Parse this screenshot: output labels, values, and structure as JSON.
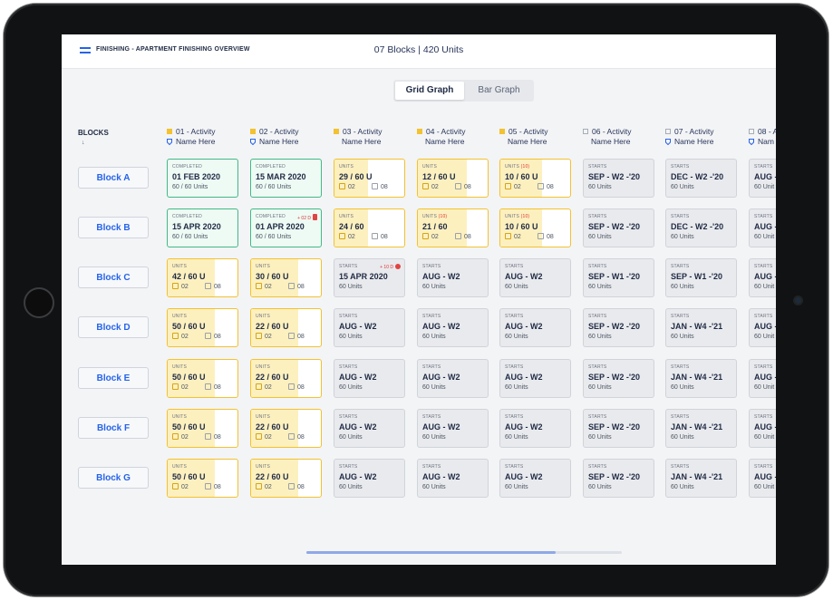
{
  "header": {
    "breadcrumb": "FINISHING - APARTMENT FINISHING OVERVIEW",
    "stats": "07 Blocks | 420 Units"
  },
  "view_toggle": {
    "options": [
      "Grid Graph",
      "Bar Graph"
    ],
    "selected": "Grid Graph"
  },
  "blocks_label": "BLOCKS",
  "sort_icon": "sort-down-arrow-icon",
  "colors": {
    "completed_border": "#43b987",
    "progress_border": "#f2c230",
    "progress_fill": "#fdf0bf",
    "activity_started": "#f2c230",
    "accent_blue": "#2563eb",
    "delay_red": "#e04444"
  },
  "columns": [
    {
      "activity": "01 - Activity",
      "name": "Name Here",
      "status": "started",
      "icon": "shield"
    },
    {
      "activity": "02 - Activity",
      "name": "Name Here",
      "status": "started",
      "icon": "shield"
    },
    {
      "activity": "03 - Activity",
      "name": "Name Here",
      "status": "started",
      "icon": ""
    },
    {
      "activity": "04 - Activity",
      "name": "Name Here",
      "status": "started",
      "icon": ""
    },
    {
      "activity": "05 - Activity",
      "name": "Name Here",
      "status": "started",
      "icon": ""
    },
    {
      "activity": "06 - Activity",
      "name": "Name Here",
      "status": "not-started",
      "icon": ""
    },
    {
      "activity": "07 - Activity",
      "name": "Name Here",
      "status": "not-started",
      "icon": "shield"
    },
    {
      "activity": "08 - A",
      "name": "Nam",
      "status": "not-started",
      "icon": "shield"
    }
  ],
  "blocks": [
    {
      "name": "Block A",
      "cells": [
        {
          "type": "completed",
          "label": "COMPLETED",
          "main": "01 FEB 2020",
          "sub": "60 / 60 Units"
        },
        {
          "type": "completed",
          "label": "COMPLETED",
          "main": "15 MAR 2020",
          "sub": "60 / 60 Units"
        },
        {
          "type": "progress",
          "label": "UNITS",
          "main": "29 / 60 U",
          "a": "02",
          "b": "08",
          "progress": 0.48
        },
        {
          "type": "progress",
          "label": "UNITS",
          "main": "12 / 60 U",
          "a": "02",
          "b": "08",
          "progress": 0.7
        },
        {
          "type": "progress",
          "label": "UNITS",
          "extra": "(10)",
          "main": "10 / 60 U",
          "a": "02",
          "b": "08",
          "progress": 0.6
        },
        {
          "type": "starts",
          "label": "STARTS",
          "main": "SEP - W2 -'20",
          "sub": "60 Units"
        },
        {
          "type": "starts",
          "label": "STARTS",
          "main": "DEC - W2 -'20",
          "sub": "60 Units"
        },
        {
          "type": "starts",
          "label": "STARTS",
          "main": "AUG -",
          "sub": "60 Unit"
        }
      ]
    },
    {
      "name": "Block B",
      "cells": [
        {
          "type": "completed",
          "label": "COMPLETED",
          "main": "15 APR 2020",
          "sub": "60 / 60 Units"
        },
        {
          "type": "completed",
          "label": "COMPLETED",
          "delay": "+ 02 D",
          "delay_marker": "badge",
          "main": "01 APR 2020",
          "sub": "60 / 60 Units"
        },
        {
          "type": "progress",
          "label": "UNITS",
          "main": "24 / 60",
          "a": "02",
          "b": "08",
          "progress": 0.48
        },
        {
          "type": "progress",
          "label": "UNITS",
          "extra": "(10)",
          "main": "21 / 60",
          "a": "02",
          "b": "08",
          "progress": 0.7
        },
        {
          "type": "progress",
          "label": "UNITS",
          "extra": "(10)",
          "main": "10 / 60 U",
          "a": "02",
          "b": "08",
          "progress": 0.6
        },
        {
          "type": "starts",
          "label": "STARTS",
          "main": "SEP - W2 -'20",
          "sub": "60 Units"
        },
        {
          "type": "starts",
          "label": "STARTS",
          "main": "DEC - W2 -'20",
          "sub": "60 Units"
        },
        {
          "type": "starts",
          "label": "STARTS",
          "main": "AUG -",
          "sub": "60 Unit"
        }
      ]
    },
    {
      "name": "Block C",
      "cells": [
        {
          "type": "progress",
          "label": "UNITS",
          "main": "42 / 60 U",
          "a": "02",
          "b": "08",
          "progress": 0.68
        },
        {
          "type": "progress",
          "label": "UNITS",
          "main": "30 / 60 U",
          "a": "02",
          "b": "08",
          "progress": 0.68
        },
        {
          "type": "starts",
          "label": "STARTS",
          "delay": "+ 10 D",
          "delay_marker": "dot",
          "main": "15 APR 2020",
          "sub": "60 Units"
        },
        {
          "type": "starts",
          "label": "STARTS",
          "main": "AUG - W2",
          "sub": "60 Units"
        },
        {
          "type": "starts",
          "label": "STARTS",
          "main": "AUG - W2",
          "sub": "60 Units"
        },
        {
          "type": "starts",
          "label": "STARTS",
          "main": "SEP - W1 -'20",
          "sub": "60 Units"
        },
        {
          "type": "starts",
          "label": "STARTS",
          "main": "SEP - W1 -'20",
          "sub": "60 Units"
        },
        {
          "type": "starts",
          "label": "STARTS",
          "main": "AUG -",
          "sub": "60 Unit"
        }
      ]
    },
    {
      "name": "Block D",
      "cells": [
        {
          "type": "progress",
          "label": "UNITS",
          "main": "50 / 60 U",
          "a": "02",
          "b": "08",
          "progress": 0.68
        },
        {
          "type": "progress",
          "label": "UNITS",
          "main": "22 / 60 U",
          "a": "02",
          "b": "08",
          "progress": 0.68
        },
        {
          "type": "starts",
          "label": "STARTS",
          "main": "AUG - W2",
          "sub": "60 Units"
        },
        {
          "type": "starts",
          "label": "STARTS",
          "main": "AUG - W2",
          "sub": "60 Units"
        },
        {
          "type": "starts",
          "label": "STARTS",
          "main": "AUG - W2",
          "sub": "60 Units"
        },
        {
          "type": "starts",
          "label": "STARTS",
          "main": "SEP - W2 -'20",
          "sub": "60 Units"
        },
        {
          "type": "starts",
          "label": "STARTS",
          "main": "JAN - W4 -'21",
          "sub": "60 Units"
        },
        {
          "type": "starts",
          "label": "STARTS",
          "main": "AUG -",
          "sub": "60 Unit"
        }
      ]
    },
    {
      "name": "Block E",
      "cells": [
        {
          "type": "progress",
          "label": "UNITS",
          "main": "50 / 60 U",
          "a": "02",
          "b": "08",
          "progress": 0.68
        },
        {
          "type": "progress",
          "label": "UNITS",
          "main": "22 / 60 U",
          "a": "02",
          "b": "08",
          "progress": 0.68
        },
        {
          "type": "starts",
          "label": "STARTS",
          "main": "AUG - W2",
          "sub": "60 Units"
        },
        {
          "type": "starts",
          "label": "STARTS",
          "main": "AUG - W2",
          "sub": "60 Units"
        },
        {
          "type": "starts",
          "label": "STARTS",
          "main": "AUG - W2",
          "sub": "60 Units"
        },
        {
          "type": "starts",
          "label": "STARTS",
          "main": "SEP - W2 -'20",
          "sub": "60 Units"
        },
        {
          "type": "starts",
          "label": "STARTS",
          "main": "JAN - W4 -'21",
          "sub": "60 Units"
        },
        {
          "type": "starts",
          "label": "STARTS",
          "main": "AUG -",
          "sub": "60 Unit"
        }
      ]
    },
    {
      "name": "Block F",
      "cells": [
        {
          "type": "progress",
          "label": "UNITS",
          "main": "50 / 60 U",
          "a": "02",
          "b": "08",
          "progress": 0.68
        },
        {
          "type": "progress",
          "label": "UNITS",
          "main": "22 / 60 U",
          "a": "02",
          "b": "08",
          "progress": 0.68
        },
        {
          "type": "starts",
          "label": "STARTS",
          "main": "AUG - W2",
          "sub": "60 Units"
        },
        {
          "type": "starts",
          "label": "STARTS",
          "main": "AUG - W2",
          "sub": "60 Units"
        },
        {
          "type": "starts",
          "label": "STARTS",
          "main": "AUG - W2",
          "sub": "60 Units"
        },
        {
          "type": "starts",
          "label": "STARTS",
          "main": "SEP - W2 -'20",
          "sub": "60 Units"
        },
        {
          "type": "starts",
          "label": "STARTS",
          "main": "JAN - W4 -'21",
          "sub": "60 Units"
        },
        {
          "type": "starts",
          "label": "STARTS",
          "main": "AUG -",
          "sub": "60 Unit"
        }
      ]
    },
    {
      "name": "Block G",
      "cells": [
        {
          "type": "progress",
          "label": "UNITS",
          "main": "50 / 60 U",
          "a": "02",
          "b": "08",
          "progress": 0.68
        },
        {
          "type": "progress",
          "label": "UNITS",
          "main": "22 / 60 U",
          "a": "02",
          "b": "08",
          "progress": 0.68
        },
        {
          "type": "starts",
          "label": "STARTS",
          "main": "AUG - W2",
          "sub": "60 Units"
        },
        {
          "type": "starts",
          "label": "STARTS",
          "main": "AUG - W2",
          "sub": "60 Units"
        },
        {
          "type": "starts",
          "label": "STARTS",
          "main": "AUG - W2",
          "sub": "60 Units"
        },
        {
          "type": "starts",
          "label": "STARTS",
          "main": "SEP - W2 -'20",
          "sub": "60 Units"
        },
        {
          "type": "starts",
          "label": "STARTS",
          "main": "JAN - W4 -'21",
          "sub": "60 Units"
        },
        {
          "type": "starts",
          "label": "STARTS",
          "main": "AUG -",
          "sub": "60 Unit"
        }
      ]
    }
  ],
  "scrollbar": {
    "position": 0.79
  }
}
